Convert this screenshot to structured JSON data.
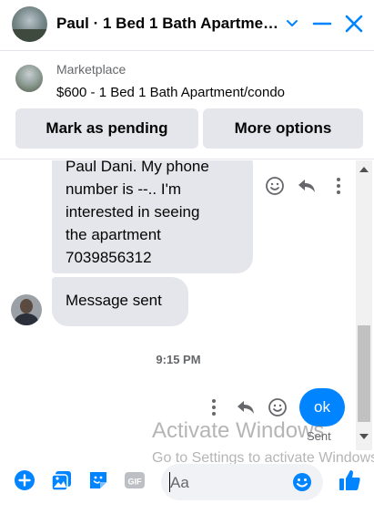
{
  "header": {
    "title": "Paul · 1 Bed 1 Bath Apartment/condo"
  },
  "listing": {
    "label": "Marketplace",
    "description": "$600 - 1 Bed 1 Bath Apartment/condo",
    "pending_button": "Mark as pending",
    "more_button": "More options"
  },
  "conversation": {
    "message_1_lines": [
      "Paul Dani. My phone",
      "number is --.. I'm",
      "interested in seeing",
      "the apartment",
      "7039856312"
    ],
    "message_2": "Message sent",
    "timestamp": "9:15 PM",
    "outgoing_message": "ok",
    "outgoing_status": "Sent"
  },
  "watermark": {
    "line1": "Activate Windows",
    "line2": "Go to Settings to activate Windows."
  },
  "composer": {
    "placeholder": "Aa"
  },
  "colors": {
    "accent": "#0084ff",
    "bubble_incoming": "#e4e6eb",
    "secondary_text": "#65676b"
  }
}
